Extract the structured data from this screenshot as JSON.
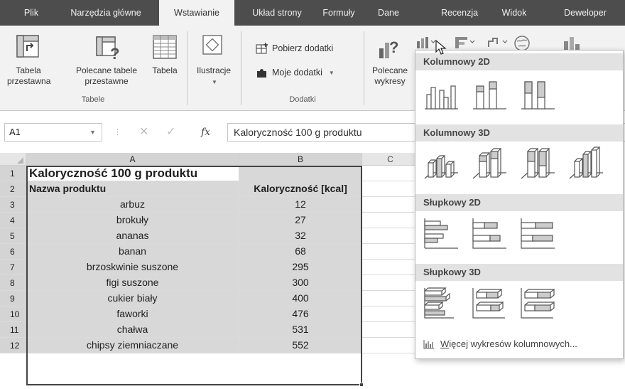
{
  "tabs": [
    "Plik",
    "Narzędzia główne",
    "Wstawianie",
    "Układ strony",
    "Formuły",
    "Dane",
    "Recenzja",
    "Widok",
    "Deweloper"
  ],
  "ribbon": {
    "pivot_table": "Tabela\nprzestawna",
    "recommended_pivot": "Polecane tabele\nprzestawne",
    "table": "Tabela",
    "tables_group": "Tabele",
    "illustrations": "Ilustracje",
    "get_addins": "Pobierz dodatki",
    "my_addins": "Moje dodatki",
    "addins_group": "Dodatki",
    "recommended_charts": "Polecane\nwykresy"
  },
  "formula_bar": {
    "name_box": "A1",
    "fx_symbol": "fx",
    "formula": "Kaloryczność 100 g produktu"
  },
  "columns": [
    "A",
    "B",
    "C"
  ],
  "rows": [
    {
      "num": "1",
      "a": "Kaloryczność 100 g produktu",
      "b": ""
    },
    {
      "num": "2",
      "a": "Nazwa produktu",
      "b": "Kaloryczność [kcal]"
    },
    {
      "num": "3",
      "a": "arbuz",
      "b": "12"
    },
    {
      "num": "4",
      "a": "brokuły",
      "b": "27"
    },
    {
      "num": "5",
      "a": "ananas",
      "b": "32"
    },
    {
      "num": "6",
      "a": "banan",
      "b": "68"
    },
    {
      "num": "7",
      "a": "brzoskwinie suszone",
      "b": "295"
    },
    {
      "num": "8",
      "a": "figi suszone",
      "b": "300"
    },
    {
      "num": "9",
      "a": "cukier biały",
      "b": "400"
    },
    {
      "num": "10",
      "a": "faworki",
      "b": "476"
    },
    {
      "num": "11",
      "a": "chałwa",
      "b": "531"
    },
    {
      "num": "12",
      "a": "chipsy ziemniaczane",
      "b": "552"
    }
  ],
  "dropdown": {
    "section_col2d": "Kolumnowy 2D",
    "section_col3d": "Kolumnowy 3D",
    "section_bar2d": "Słupkowy 2D",
    "section_bar3d": "Słupkowy 3D",
    "more_link_accel": "W",
    "more_link_rest": "ięcej wykresów kolumnowych..."
  },
  "colors": {
    "tabbar_bg": "#4d4d4d",
    "ribbon_bg": "#f2f2f2",
    "selection_shade": "#d8d8d8",
    "section_bg": "#e2e2e2"
  }
}
